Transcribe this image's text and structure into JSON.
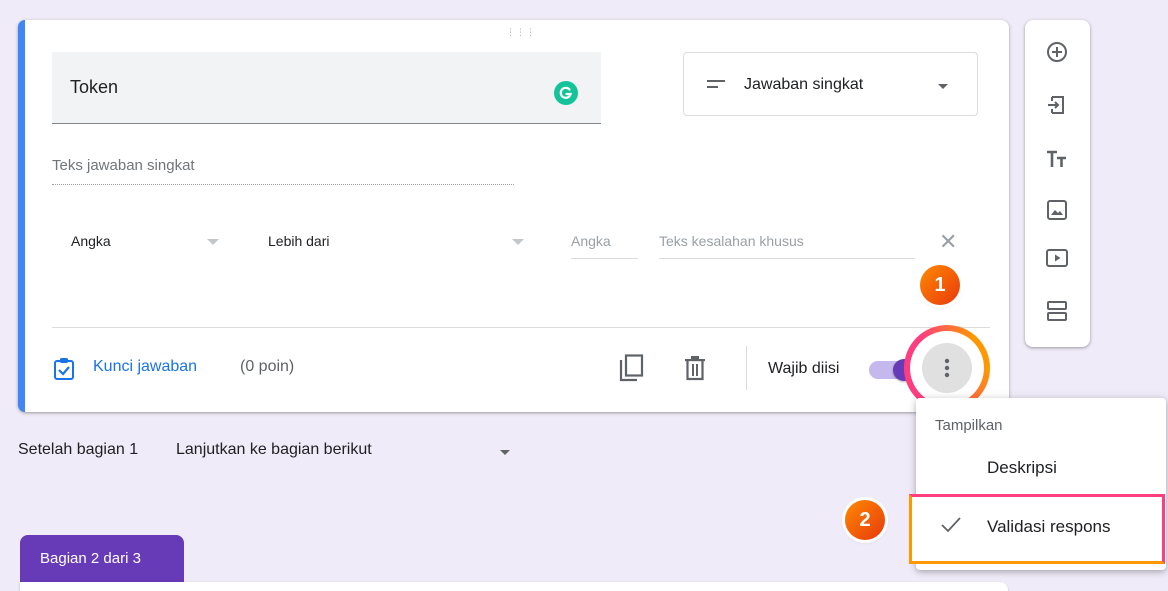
{
  "colors": {
    "accent": "#673ab7",
    "accent_bar": "#4285f4",
    "link": "#1a73e8",
    "badge": "#ff6d00",
    "highlight_pink": "#ff3d7f",
    "highlight_orange": "#ff9800"
  },
  "question": {
    "title": "Token",
    "type_label": "Jawaban singkat",
    "short_answer_placeholder": "Teks jawaban singkat"
  },
  "validation": {
    "type": "Angka",
    "condition": "Lebih dari",
    "number_placeholder": "Angka",
    "error_placeholder": "Teks kesalahan khusus"
  },
  "footer": {
    "answer_key_label": "Kunci jawaban",
    "points_label": "(0 poin)",
    "required_label": "Wajib diisi",
    "required_on": true
  },
  "badges": {
    "first": "1",
    "second": "2"
  },
  "menu": {
    "header": "Tampilkan",
    "items": [
      {
        "label": "Deskripsi",
        "checked": false
      },
      {
        "label": "Validasi respons",
        "checked": true
      }
    ]
  },
  "section_nav": {
    "after_label": "Setelah bagian 1",
    "after_value": "Lanjutkan ke bagian berikut"
  },
  "section_tab": {
    "label": "Bagian 2 dari 3"
  },
  "toolbar": {
    "icons": [
      "add-question-icon",
      "import-questions-icon",
      "add-title-icon",
      "add-image-icon",
      "add-video-icon",
      "add-section-icon"
    ]
  }
}
